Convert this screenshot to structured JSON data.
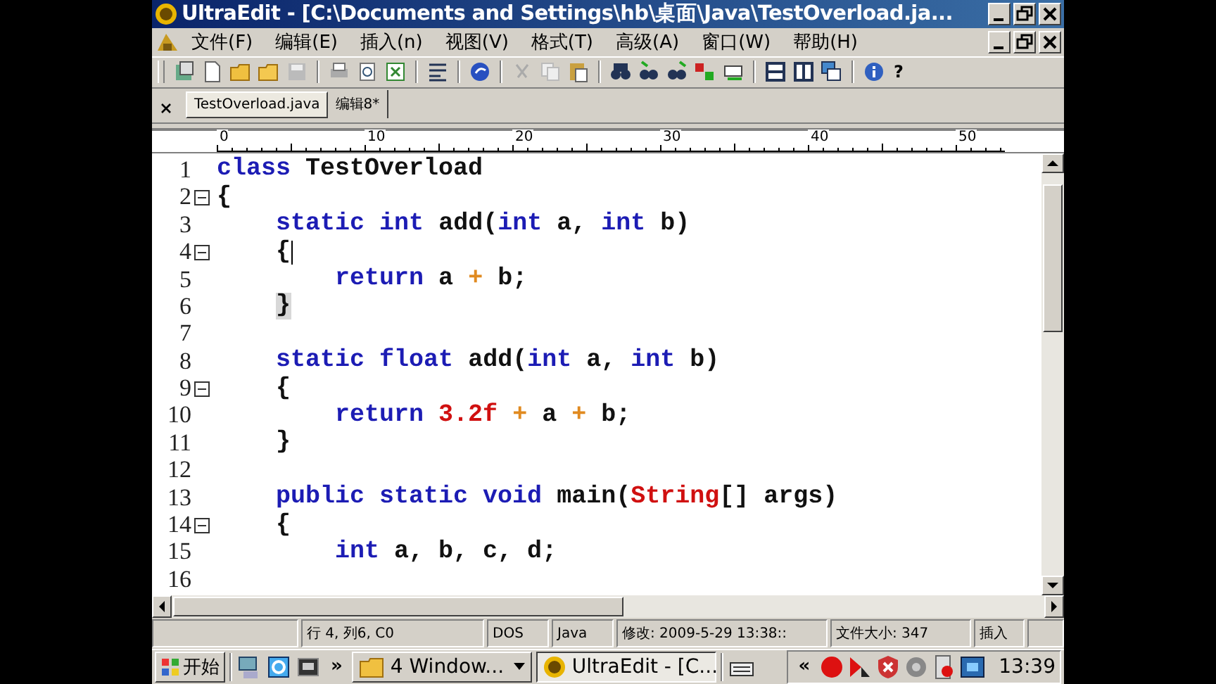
{
  "window": {
    "title": "UltraEdit - [C:\\Documents and Settings\\hb\\桌面\\Java\\TestOverload.ja..."
  },
  "menu": [
    "文件(F)",
    "编辑(E)",
    "插入(n)",
    "视图(V)",
    "格式(T)",
    "高级(A)",
    "窗口(W)",
    "帮助(H)"
  ],
  "toolbar": {
    "help_text": "?"
  },
  "tabs": [
    {
      "label": "TestOverload.java",
      "selected": true
    },
    {
      "label": "编辑8*",
      "selected": false
    }
  ],
  "ruler": [
    "0",
    "10",
    "20",
    "30",
    "40",
    "50"
  ],
  "editor": {
    "lines": [
      {
        "number": "1",
        "fold": false,
        "tokens": [
          {
            "kind": "kw",
            "text": "class"
          },
          {
            "kind": "id",
            "text": " TestOverload"
          }
        ]
      },
      {
        "number": "2",
        "fold": true,
        "tokens": [
          {
            "kind": "id",
            "text": "{"
          }
        ]
      },
      {
        "number": "3",
        "fold": false,
        "tokens": [
          {
            "kind": "kw",
            "text": "    static int"
          },
          {
            "kind": "id",
            "text": " add("
          },
          {
            "kind": "kw",
            "text": "int"
          },
          {
            "kind": "id",
            "text": " a, "
          },
          {
            "kind": "kw",
            "text": "int"
          },
          {
            "kind": "id",
            "text": " b)"
          }
        ]
      },
      {
        "number": "4",
        "fold": true,
        "caret": true,
        "tokens": [
          {
            "kind": "id",
            "text": "    {"
          }
        ]
      },
      {
        "number": "5",
        "fold": false,
        "tokens": [
          {
            "kind": "kw",
            "text": "        return"
          },
          {
            "kind": "id",
            "text": " a "
          },
          {
            "kind": "op",
            "text": "+"
          },
          {
            "kind": "id",
            "text": " b;"
          }
        ]
      },
      {
        "number": "6",
        "fold": false,
        "tokens": [
          {
            "kind": "match",
            "text": "    }"
          }
        ]
      },
      {
        "number": "7",
        "fold": false
      },
      {
        "number": "8",
        "fold": false,
        "tokens": [
          {
            "kind": "kw",
            "text": "    static float"
          },
          {
            "kind": "id",
            "text": " add("
          },
          {
            "kind": "kw",
            "text": "int"
          },
          {
            "kind": "id",
            "text": " a, "
          },
          {
            "kind": "kw",
            "text": "int"
          },
          {
            "kind": "id",
            "text": " b)"
          }
        ]
      },
      {
        "number": "9",
        "fold": true,
        "tokens": [
          {
            "kind": "id",
            "text": "    {"
          }
        ]
      },
      {
        "number": "10",
        "fold": false,
        "tokens": [
          {
            "kind": "kw",
            "text": "        return"
          },
          {
            "kind": "num",
            "text": " 3.2f"
          },
          {
            "kind": "op",
            "text": " +"
          },
          {
            "kind": "id",
            "text": " a"
          },
          {
            "kind": "op",
            "text": " +"
          },
          {
            "kind": "id",
            "text": " b;"
          }
        ]
      },
      {
        "number": "11",
        "fold": false,
        "tokens": [
          {
            "kind": "id",
            "text": "    }"
          }
        ]
      },
      {
        "number": "12",
        "fold": false
      },
      {
        "number": "13",
        "fold": false,
        "tokens": [
          {
            "kind": "kw",
            "text": "    public static void"
          },
          {
            "kind": "id",
            "text": " main("
          },
          {
            "kind": "num",
            "text": "String"
          },
          {
            "kind": "id",
            "text": "[] args)"
          }
        ]
      },
      {
        "number": "14",
        "fold": true,
        "tokens": [
          {
            "kind": "id",
            "text": "    {"
          }
        ]
      },
      {
        "number": "15",
        "fold": false,
        "tokens": [
          {
            "kind": "kw",
            "text": "        int"
          },
          {
            "kind": "id",
            "text": " a, b, c, d;"
          }
        ]
      },
      {
        "number": "16",
        "fold": false
      }
    ]
  },
  "status_bar": [
    "行 4, 列6, C0",
    "DOS",
    "Java",
    "修改:  2009-5-29 13:38::",
    "文件大小:  347",
    "插入"
  ],
  "taskbar": {
    "start": "开始",
    "more": "»",
    "tasks": [
      {
        "label": "4 Window...",
        "kind": "folder",
        "selected": false
      },
      {
        "label": "UltraEdit - [C...",
        "kind": "app",
        "selected": true
      }
    ],
    "tray_more": "«",
    "clock": "13:39"
  }
}
